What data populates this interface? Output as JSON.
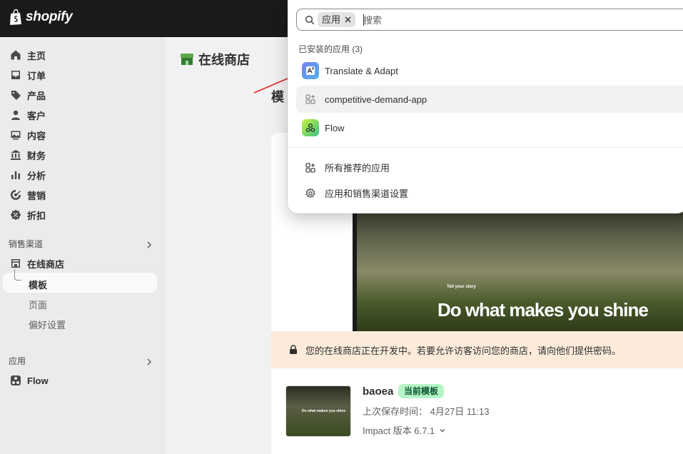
{
  "topbar": {
    "logo_text": "shopify"
  },
  "sidebar": {
    "items": [
      {
        "label": "主页",
        "icon": "home-icon"
      },
      {
        "label": "订单",
        "icon": "inbox-icon"
      },
      {
        "label": "产品",
        "icon": "tag-icon"
      },
      {
        "label": "客户",
        "icon": "person-icon"
      },
      {
        "label": "内容",
        "icon": "image-icon"
      },
      {
        "label": "财务",
        "icon": "bank-icon"
      },
      {
        "label": "分析",
        "icon": "bar-chart-icon"
      },
      {
        "label": "营销",
        "icon": "target-icon"
      },
      {
        "label": "折扣",
        "icon": "discount-icon"
      }
    ],
    "sales_channels_label": "销售渠道",
    "online_store_label": "在线商店",
    "sub_items": [
      "模板",
      "页面",
      "偏好设置"
    ],
    "apps_label": "应用",
    "flow_label": "Flow"
  },
  "main": {
    "title": "在线商店",
    "partial_heading": "模",
    "preview_small_text": "Tell your story",
    "preview_big_text": "Do what makes you shine",
    "banner_text": "您的在线商店正在开发中。若要允许访客访问您的商店，请向他们提供密码。",
    "thumb_text": "Do what makes you shine",
    "theme_name": "baoea",
    "theme_badge": "当前模板",
    "last_saved": "上次保存时间：  4月27日 11:13",
    "version": "Impact 版本 6.7.1"
  },
  "popup": {
    "search": {
      "chip_label": "应用",
      "placeholder": "搜索"
    },
    "group_title": "已安装的应用 (3)",
    "apps": [
      {
        "label": "Translate & Adapt",
        "icon": "translate-icon"
      },
      {
        "label": "competitive-demand-app",
        "icon": "app-grid-icon"
      },
      {
        "label": "Flow",
        "icon": "flow-icon"
      }
    ],
    "links": [
      {
        "label": "所有推荐的应用",
        "icon": "apps-icon"
      },
      {
        "label": "应用和销售渠道设置",
        "icon": "gear-icon"
      }
    ]
  },
  "colors": {
    "topbar": "#1a1a1a",
    "sidebar": "#ebebeb",
    "badge_bg": "#b5f5c5",
    "banner_bg": "#fcebdb",
    "arrow": "#e02020"
  }
}
